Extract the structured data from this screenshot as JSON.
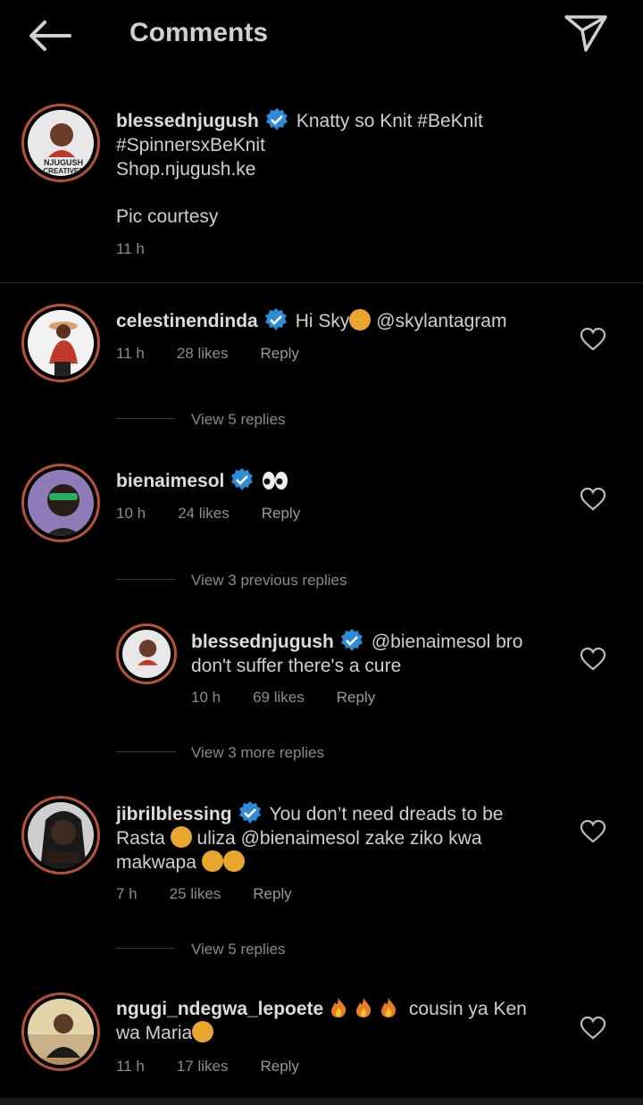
{
  "header": {
    "title": "Comments",
    "back_icon": "back-arrow-icon",
    "share_icon": "send-icon"
  },
  "caption": {
    "username": "blessednjugush",
    "line1": "Knatty so Knit #BeKnit",
    "line2": "#SpinnersxBeKnit",
    "line3": "Shop.njugush.ke",
    "line4": "Pic courtesy",
    "time": "11 h",
    "avatar_text": "NJUGUSH CREATIVES"
  },
  "comments": [
    {
      "username": "celestinendinda",
      "text": "Hi Sky",
      "mention": "@skylantagram",
      "time": "11 h",
      "likes": "28 likes",
      "reply": "Reply",
      "view": "View 5 replies"
    },
    {
      "username": "bienaimesol",
      "time": "10 h",
      "likes": "24 likes",
      "reply": "Reply",
      "view": "View 3 previous replies"
    },
    {
      "username": "blessednjugush",
      "line1": "@bienaimesol bro",
      "line2": "don't suffer there's a cure",
      "time": "10 h",
      "likes": "69 likes",
      "reply": "Reply",
      "view": "View 3 more replies"
    },
    {
      "username": "jibrilblessing",
      "line1": "You don’t need dreads to be",
      "line2a": "Rasta",
      "line2b": "uliza @bienaimesol zake ziko kwa",
      "line3": "makwapa",
      "time": "7 h",
      "likes": "25 likes",
      "reply": "Reply",
      "view": "View 5 replies"
    },
    {
      "username": "ngugi_ndegwa_lepoete",
      "line1": "cousin ya Ken",
      "line2": "wa Maria",
      "time": "11 h",
      "likes": "17 likes",
      "reply": "Reply"
    }
  ],
  "colors": {
    "background": "#000000",
    "verified": "#2f8bd8",
    "ring": "#b8513a"
  }
}
